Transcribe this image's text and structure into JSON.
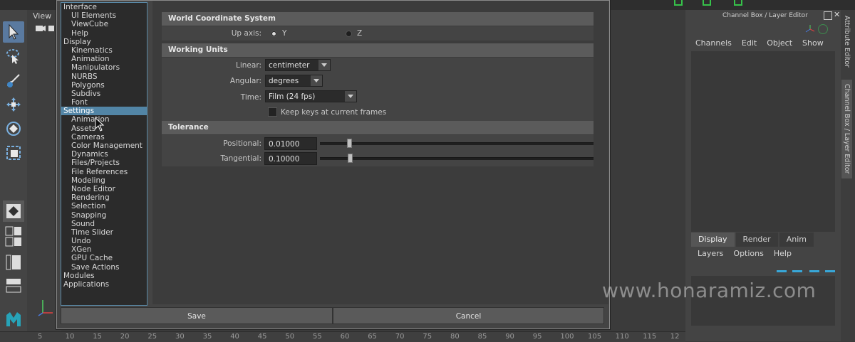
{
  "viewport": {
    "menu_label": "View"
  },
  "categories": [
    {
      "label": "Interface",
      "level": 0
    },
    {
      "label": "UI Elements",
      "level": 1
    },
    {
      "label": "ViewCube",
      "level": 1
    },
    {
      "label": "Help",
      "level": 1
    },
    {
      "label": "Display",
      "level": 0
    },
    {
      "label": "Kinematics",
      "level": 1
    },
    {
      "label": "Animation",
      "level": 1
    },
    {
      "label": "Manipulators",
      "level": 1
    },
    {
      "label": "NURBS",
      "level": 1
    },
    {
      "label": "Polygons",
      "level": 1
    },
    {
      "label": "Subdivs",
      "level": 1
    },
    {
      "label": "Font",
      "level": 1
    },
    {
      "label": "Settings",
      "level": 0,
      "selected": true
    },
    {
      "label": "Animation",
      "level": 1
    },
    {
      "label": "Assets",
      "level": 1
    },
    {
      "label": "Cameras",
      "level": 1
    },
    {
      "label": "Color Management",
      "level": 1
    },
    {
      "label": "Dynamics",
      "level": 1
    },
    {
      "label": "Files/Projects",
      "level": 1
    },
    {
      "label": "File References",
      "level": 1
    },
    {
      "label": "Modeling",
      "level": 1
    },
    {
      "label": "Node Editor",
      "level": 1
    },
    {
      "label": "Rendering",
      "level": 1
    },
    {
      "label": "Selection",
      "level": 1
    },
    {
      "label": "Snapping",
      "level": 1
    },
    {
      "label": "Sound",
      "level": 1
    },
    {
      "label": "Time Slider",
      "level": 1
    },
    {
      "label": "Undo",
      "level": 1
    },
    {
      "label": "XGen",
      "level": 1
    },
    {
      "label": "GPU Cache",
      "level": 1
    },
    {
      "label": "Save Actions",
      "level": 1
    },
    {
      "label": "Modules",
      "level": 0
    },
    {
      "label": "Applications",
      "level": 0
    }
  ],
  "wcs": {
    "title": "World Coordinate System",
    "up_axis_label": "Up axis:",
    "y_label": "Y",
    "z_label": "Z",
    "selected": "Y"
  },
  "units": {
    "title": "Working Units",
    "linear_label": "Linear:",
    "linear_value": "centimeter",
    "angular_label": "Angular:",
    "angular_value": "degrees",
    "time_label": "Time:",
    "time_value": "Film (24 fps)",
    "keep_keys_label": "Keep keys at current frames",
    "keep_keys_checked": false
  },
  "tolerance": {
    "title": "Tolerance",
    "positional_label": "Positional:",
    "positional_value": "0.01000",
    "tangential_label": "Tangential:",
    "tangential_value": "0.10000"
  },
  "buttons": {
    "save": "Save",
    "cancel": "Cancel"
  },
  "channel_box": {
    "title": "Channel Box / Layer Editor",
    "menu": [
      "Channels",
      "Edit",
      "Object",
      "Show"
    ],
    "side_tabs": [
      "Attribute Editor",
      "Channel Box / Layer Editor"
    ],
    "display_tabs": [
      "Display",
      "Render",
      "Anim"
    ],
    "active_display_tab": "Display",
    "layer_menu": [
      "Layers",
      "Options",
      "Help"
    ]
  },
  "time_slider": {
    "ticks": [
      "5",
      "10",
      "15",
      "20",
      "25",
      "30",
      "35",
      "40",
      "45",
      "50",
      "55",
      "60",
      "65",
      "70",
      "75",
      "80",
      "85",
      "90",
      "95",
      "100",
      "105",
      "110",
      "115",
      "12"
    ]
  },
  "watermark": "www.honaramiz.com",
  "colors": {
    "selection": "#5285a6",
    "accent_green": "#36c24a"
  }
}
